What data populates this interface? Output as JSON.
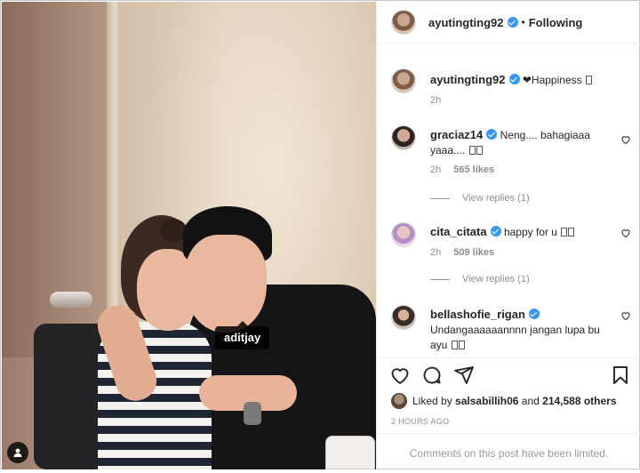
{
  "post": {
    "author": "ayutingting92",
    "separator": "•",
    "follow_status": "Following",
    "photo_tag": "aditjay"
  },
  "caption": {
    "username": "ayutingting92",
    "text": "❤Happiness",
    "time": "2h"
  },
  "comments": [
    {
      "username": "graciaz14",
      "text": "Neng.... bahagiaaa yaaa....",
      "time": "2h",
      "likes": "565 likes",
      "replies": "View replies (1)"
    },
    {
      "username": "cita_citata",
      "text": "happy for u",
      "time": "2h",
      "likes": "509 likes",
      "replies": "View replies (1)"
    },
    {
      "username": "bellashofie_rigan",
      "text": "Undangaaaaaannnn jangan lupa bu ayu",
      "time": "",
      "likes": "",
      "replies": ""
    }
  ],
  "liked_by": {
    "prefix": "Liked by",
    "user": "salsabillih06",
    "joiner": "and",
    "others": "214,588 others"
  },
  "timestamp": "2 HOURS AGO",
  "comments_notice": "Comments on this post have been limited.",
  "icons": [
    "heart-icon",
    "comment-icon",
    "share-icon",
    "bookmark-icon",
    "user-tag-icon",
    "verified-badge-icon"
  ],
  "colors": {
    "verified": "#3897f0",
    "muted": "#8e8e8e",
    "text": "#262626"
  }
}
